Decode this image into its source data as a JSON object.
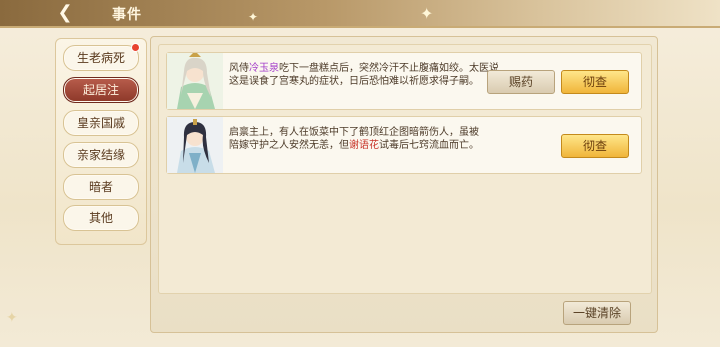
{
  "header": {
    "title": "事件",
    "back_icon": "back-arrow-icon"
  },
  "sidebar": {
    "tabs": [
      {
        "label": "生老病死",
        "has_badge": true
      },
      {
        "label": "起居注",
        "active": true
      },
      {
        "label": "皇亲国戚"
      },
      {
        "label": "亲家结缘"
      },
      {
        "label": "暗者"
      },
      {
        "label": "其他"
      }
    ]
  },
  "events": [
    {
      "text_pre": "风侍",
      "name": "冷玉泉",
      "text_post": "吃下一盘糕点后，突然冷汗不止腹痛如绞。太医说这是误食了宫寒丸的症状，日后恐怕难以祈愿求得子嗣。",
      "buttons": [
        "赐药",
        "彻查"
      ]
    },
    {
      "text_pre": "启禀主上，有人在饭菜中下了鹤顶红企图暗箭伤人，虽被陪嫁守护之人安然无恙，但",
      "name": "谢语花",
      "text_post": "试毒后七窍流血而亡。",
      "buttons": [
        "彻查"
      ]
    }
  ],
  "footer": {
    "clear_all": "一键清除"
  },
  "colors": {
    "active_tab": "#8d3829",
    "gold_button": "#f0b53a",
    "name_purple": "#a23cc9",
    "name_red": "#c8352a"
  }
}
